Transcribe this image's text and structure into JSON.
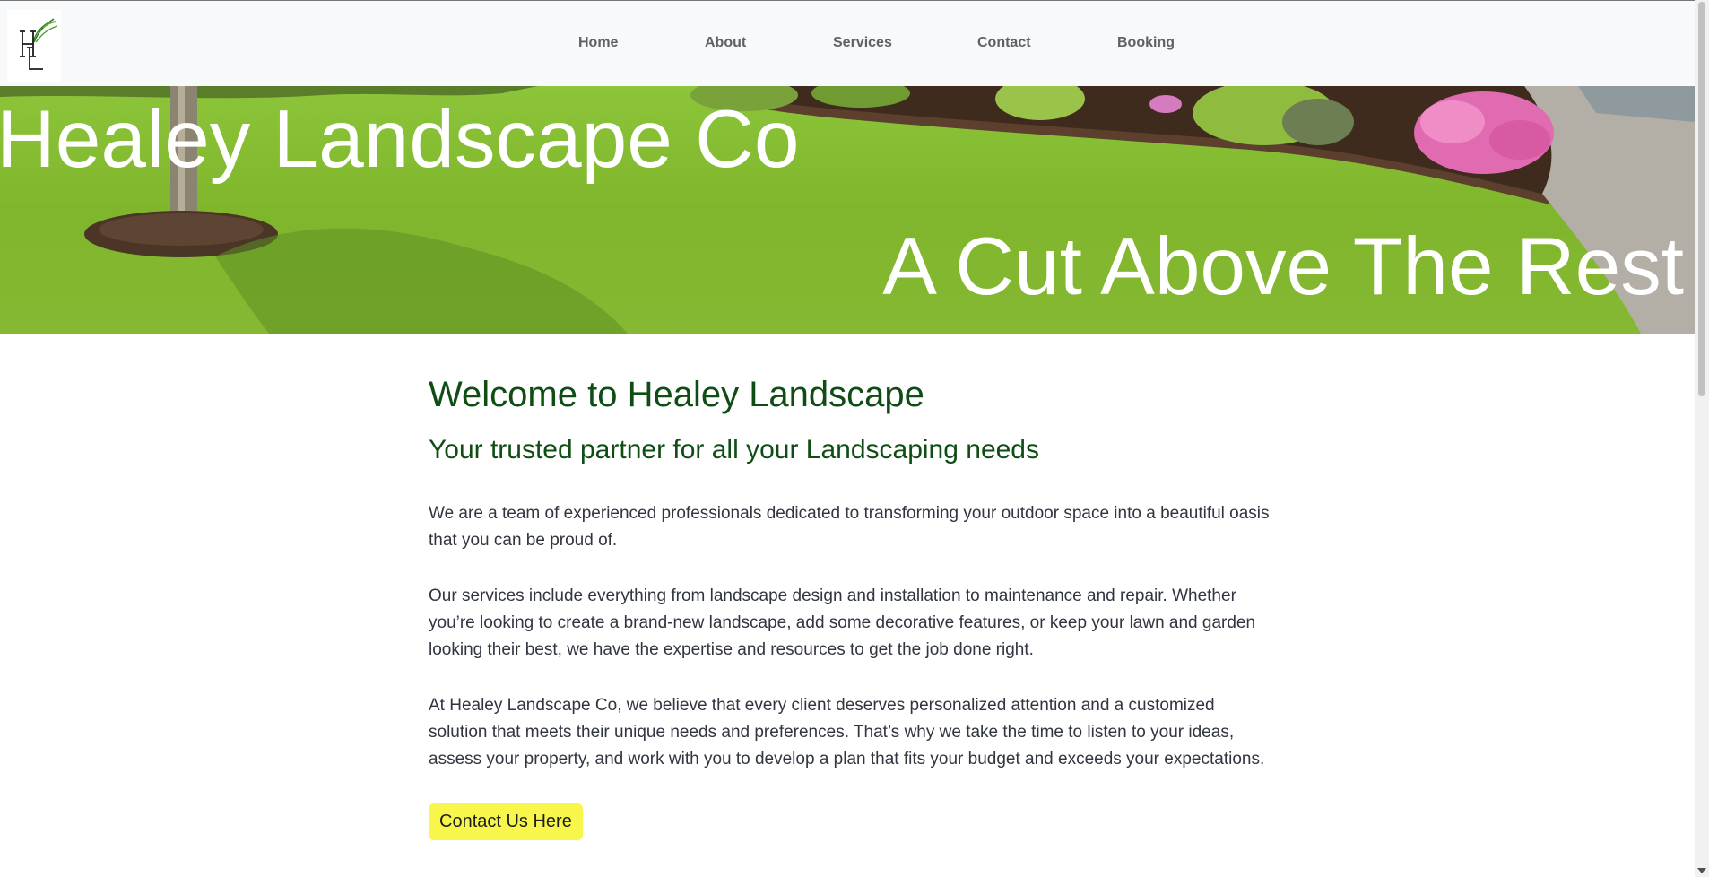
{
  "header": {
    "logo_letters": "HL",
    "nav": [
      {
        "label": "Home"
      },
      {
        "label": "About"
      },
      {
        "label": "Services"
      },
      {
        "label": "Contact"
      },
      {
        "label": "Booking"
      }
    ]
  },
  "hero": {
    "title": "Healey Landscape Co",
    "tagline": "A Cut Above The Rest"
  },
  "main": {
    "heading": "Welcome to Healey Landscape",
    "subheading": "Your trusted partner for all your Landscaping needs",
    "paragraphs": [
      "We are a team of experienced professionals dedicated to transforming your outdoor space into a beautiful oasis that you can be proud of.",
      "Our services include everything from landscape design and installation to maintenance and repair. Whether you’re looking to create a brand-new landscape, add some decorative features, or keep your lawn and garden looking their best, we have the expertise and resources to get the job done right.",
      "At Healey Landscape Co, we believe that every client deserves personalized attention and a customized solution that meets their unique needs and preferences. That’s why we take the time to listen to your ideas, assess your property, and work with you to develop a plan that fits your budget and exceeds your expectations."
    ],
    "cta_label": "Contact Us Here"
  },
  "colors": {
    "heading_green": "#0f4d14",
    "cta_yellow": "#f8f64a",
    "nav_text": "#5f6166",
    "body_text": "#303540"
  }
}
